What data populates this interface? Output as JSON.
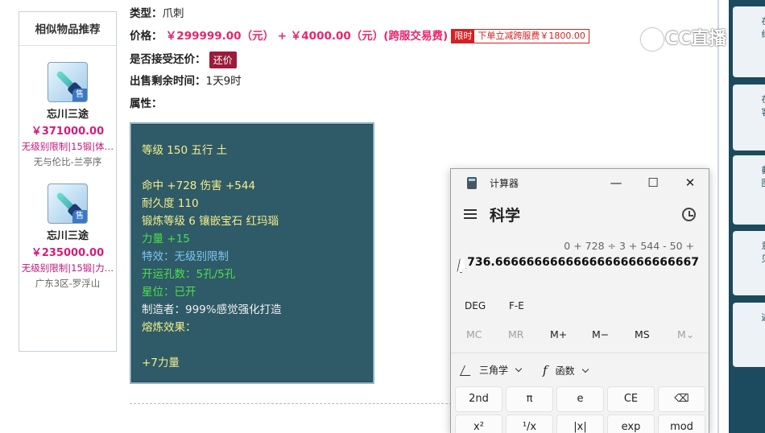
{
  "similar": {
    "title": "相似物品推荐",
    "items": [
      {
        "name": "忘川三途",
        "price": "￥371000.00",
        "tags": "无级别限制|15锻|体…",
        "server": "无与伦比-兰亭序",
        "badge": "售"
      },
      {
        "name": "忘川三途",
        "price": "￥235000.00",
        "tags": "无级别限制|15锻|力…",
        "server": "广东3区-罗浮山",
        "badge": "售"
      }
    ]
  },
  "detail": {
    "type_label": "类型：",
    "type_value": "爪刺",
    "price_label": "价格：",
    "price_value": "￥299999.00（元） + ￥4000.00（元）(跨服交易费)",
    "limit_tag": "限时",
    "limit_text": "下单立减跨服费￥1800.00",
    "bargain_label": "是否接受还价：",
    "bargain_button": "还价",
    "time_label": "出售剩余时间：",
    "time_value": "1天9时",
    "attr_label": "属性："
  },
  "attributes": {
    "lines": [
      {
        "text": "",
        "color": "yellow"
      },
      {
        "text": "等级 150 五行 土",
        "color": "yellow"
      },
      {
        "text": "",
        "color": "yellow"
      },
      {
        "text": "命中 +728 伤害 +544",
        "color": "yellow"
      },
      {
        "text": "耐久度 110",
        "color": "yellow"
      },
      {
        "text": "锻炼等级 6 镶嵌宝石 红玛瑙",
        "color": "yellow"
      },
      {
        "text": "力量 +15",
        "color": "green"
      },
      {
        "text": "特效：无级别限制",
        "color": "blue"
      },
      {
        "text": "开运孔数：5孔/5孔",
        "color": "green"
      },
      {
        "text": "星位：已开",
        "color": "green"
      },
      {
        "text": "制造者：999%感觉强化打造",
        "color": "white"
      },
      {
        "text": "熔炼效果：",
        "color": "yellow"
      },
      {
        "text": "",
        "color": "yellow"
      },
      {
        "text": "+7力量",
        "color": "yellow"
      }
    ]
  },
  "watermark": {
    "text": "CC直播"
  },
  "calculator": {
    "window_title": "计算器",
    "minimize": "—",
    "maximize": "☐",
    "close": "✕",
    "mode": "科学",
    "expression": "0 + 728 ÷ 3 + 544 - 50 +",
    "result": "736.66666666666666666666666667",
    "deg": "DEG",
    "fe": "F-E",
    "memory": [
      "MC",
      "MR",
      "M+",
      "M−",
      "MS",
      "M⌄"
    ],
    "trig_label": "三角学",
    "func_label": "函数",
    "keys_row1": [
      "2nd",
      "π",
      "e",
      "CE",
      "⌫"
    ],
    "keys_row2": [
      "x²",
      "¹/x",
      "|x|",
      "exp",
      "mod"
    ]
  },
  "right_sidebar": {
    "cards": [
      {
        "chars": "在线"
      },
      {
        "chars": "在客"
      },
      {
        "chars": "截图"
      },
      {
        "chars": "意见"
      },
      {
        "chars": "返"
      }
    ]
  }
}
